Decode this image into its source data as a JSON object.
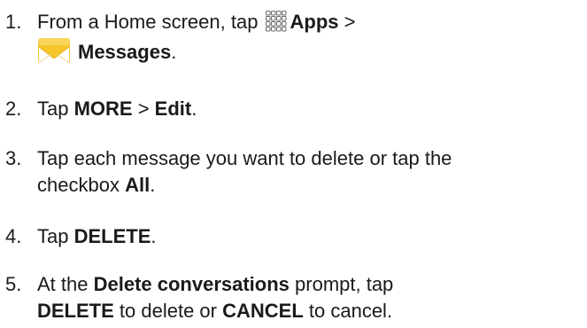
{
  "steps": [
    {
      "number": "1.",
      "line1": {
        "prefix": "From a Home screen, tap ",
        "apps_icon": "apps-grid-icon",
        "apps_label": "Apps",
        "suffix": " >"
      },
      "line2": {
        "messages_icon": "messages-envelope-icon",
        "messages_label": "Messages",
        "suffix": "."
      }
    },
    {
      "number": "2.",
      "t1": "Tap ",
      "b1": "MORE",
      "t2": " > ",
      "b2": "Edit",
      "t3": "."
    },
    {
      "number": "3.",
      "line1": "Tap each message you want to delete or tap the",
      "line2_text": "checkbox ",
      "line2_bold": "All",
      "line2_end": "."
    },
    {
      "number": "4.",
      "t1": "Tap ",
      "b1": "DELETE",
      "t2": "."
    },
    {
      "number": "5.",
      "line1_a": "At the ",
      "line1_bold": "Delete conversations",
      "line1_b": " prompt, tap",
      "line2_bold1": "DELETE",
      "line2_a": " to delete or ",
      "line2_bold2": "CANCEL",
      "line2_b": " to cancel."
    }
  ],
  "colors": {
    "text": "#1a1a1a",
    "messages_icon_envelope": "#f6c52b",
    "apps_icon_stroke": "#6b6b6b"
  }
}
